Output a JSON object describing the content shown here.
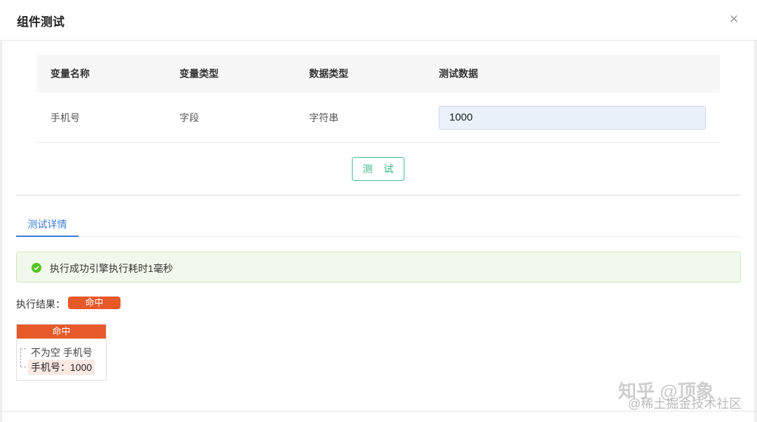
{
  "dialog": {
    "title": "组件测试",
    "close_icon": "×"
  },
  "table": {
    "headers": [
      "变量名称",
      "变量类型",
      "数据类型",
      "测试数据"
    ],
    "rows": [
      {
        "name": "手机号",
        "var_type": "字段",
        "data_type": "字符串",
        "test_value": "1000"
      }
    ]
  },
  "test_button": "测 试",
  "tabs": {
    "active": "测试详情"
  },
  "alert": {
    "type": "success",
    "message": "执行成功引擎执行耗时1毫秒",
    "color": "#52c41a"
  },
  "result": {
    "label": "执行结果：",
    "badge": "命中",
    "badge_color": "#e8592a"
  },
  "node": {
    "header": "命中",
    "line1": "不为空 手机号",
    "line2": "手机号：1000"
  },
  "watermark": {
    "line1": "知乎 @顶象",
    "line2": "@稀土掘金技术社区"
  }
}
